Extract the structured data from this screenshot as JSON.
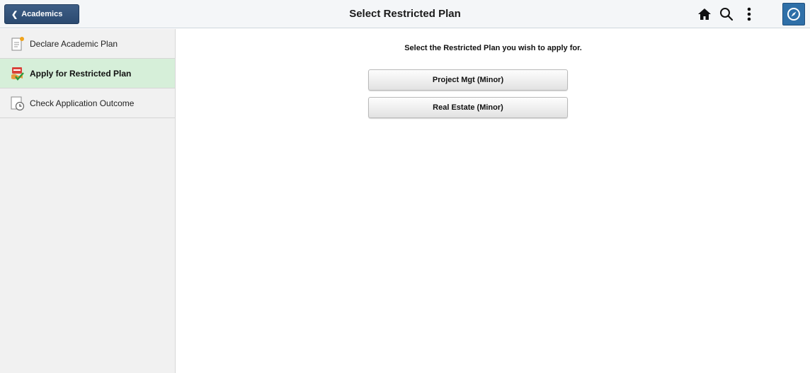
{
  "header": {
    "back_label": "Academics",
    "title": "Select Restricted Plan",
    "icons": [
      "home-icon",
      "search-icon",
      "actions-menu-icon",
      "navbar-compass-icon"
    ],
    "accent_color": "#2e6fa8"
  },
  "sidebar": {
    "items": [
      {
        "label": "Declare Academic Plan",
        "icon": "document-icon",
        "active": false
      },
      {
        "label": "Apply for Restricted Plan",
        "icon": "restricted-plan-icon",
        "active": true
      },
      {
        "label": "Check Application Outcome",
        "icon": "document-clock-icon",
        "active": false
      }
    ],
    "active_color": "#d6efd9"
  },
  "main": {
    "prompt": "Select the Restricted Plan you wish to apply for.",
    "plans": [
      {
        "label": "Project Mgt (Minor)"
      },
      {
        "label": "Real Estate (Minor)"
      }
    ]
  }
}
